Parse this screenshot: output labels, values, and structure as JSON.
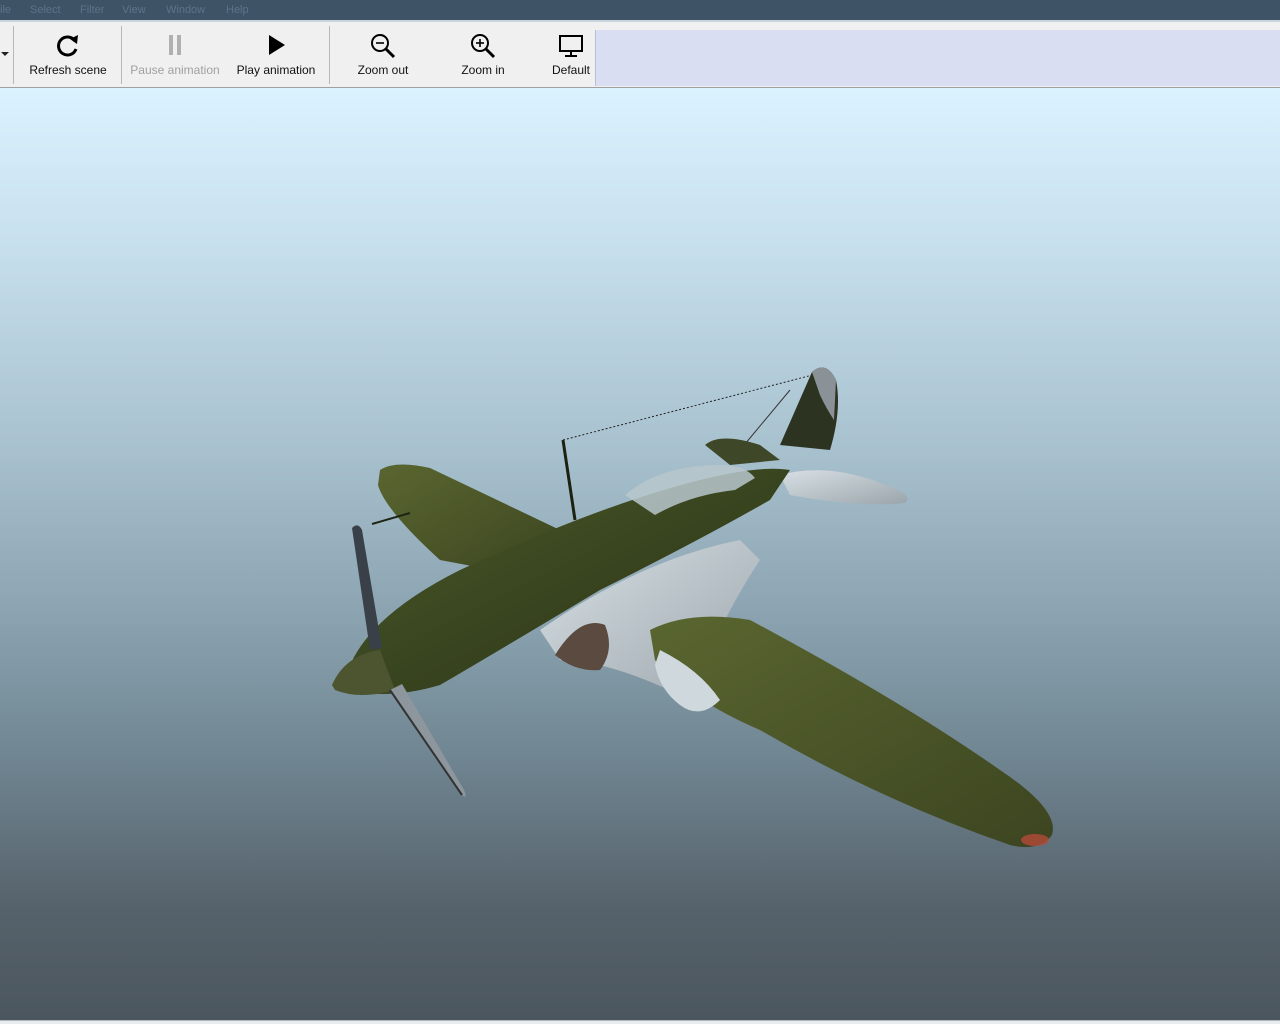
{
  "menu": {
    "items": [
      "ile",
      "Select",
      "Filter",
      "View",
      "Window",
      "Help"
    ]
  },
  "toolbar": {
    "refresh_label": "Refresh scene",
    "pause_label": "Pause animation",
    "play_label": "Play animation",
    "zoom_out_label": "Zoom out",
    "zoom_in_label": "Zoom in",
    "default_label": "Default"
  },
  "icons": {
    "refresh": "refresh-icon",
    "pause": "pause-icon",
    "play": "play-icon",
    "zoom_out": "zoom-out-icon",
    "zoom_in": "zoom-in-icon",
    "default": "monitor-icon"
  },
  "colors": {
    "sky_top": "#dbf2ff",
    "sky_bottom": "#4b565e",
    "plane_body": "#3c4a22"
  },
  "viewport": {
    "model": "WWII fighter aircraft"
  }
}
